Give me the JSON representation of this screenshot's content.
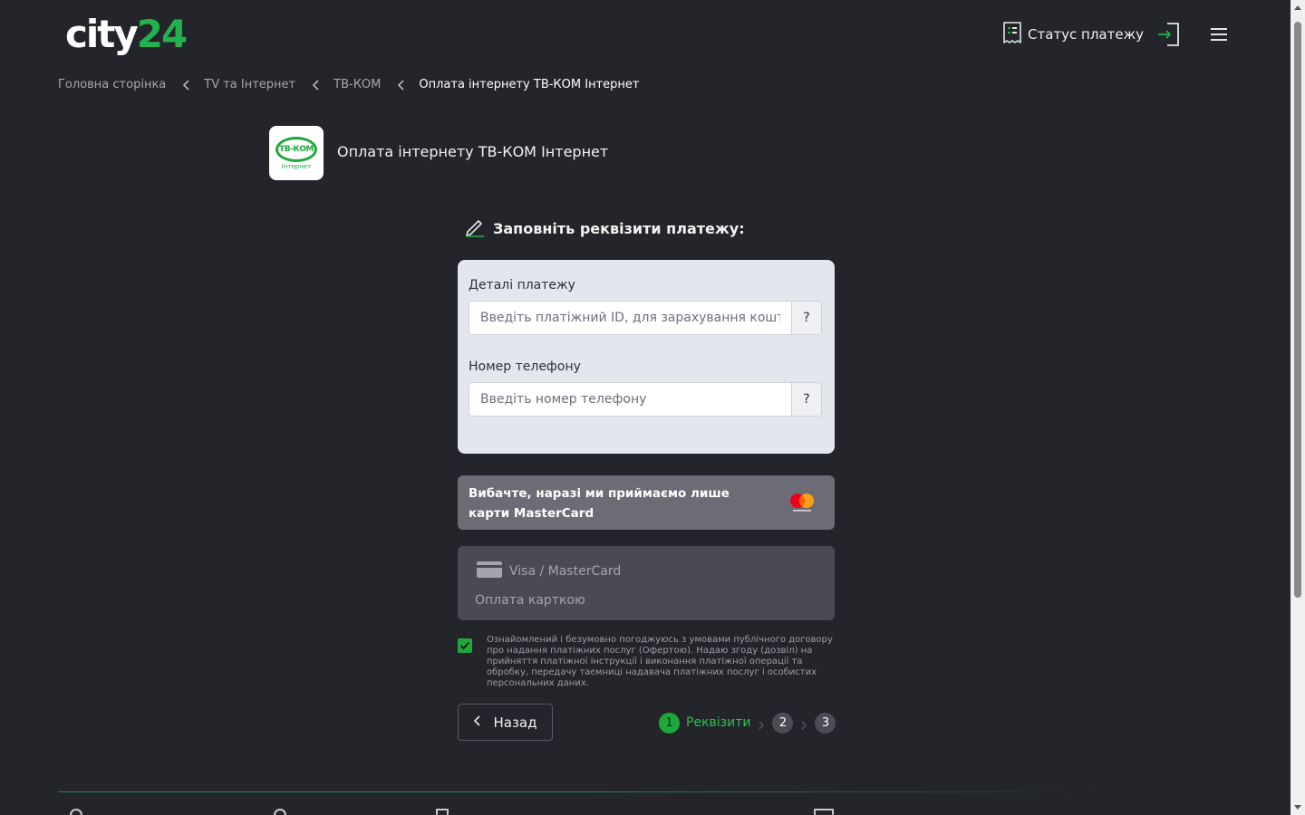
{
  "header": {
    "logo_white": "city",
    "logo_green": "24",
    "status_label": "Статус платежу"
  },
  "breadcrumb": {
    "items": [
      "Головна сторінка",
      "TV та Інтернет",
      "ТВ-КОМ"
    ],
    "current": "Оплата інтернету ТВ-КОМ Інтернет"
  },
  "provider": {
    "logo_text": "ТВ-КОМ",
    "logo_sub": "Інтернет",
    "title": "Оплата інтернету ТВ-КОМ Інтернет"
  },
  "form": {
    "section_title": "Заповніть реквізити платежу:",
    "fields": [
      {
        "label": "Деталі платежу",
        "placeholder": "Введіть платіжний ID, для зарахування коштів",
        "help": "?"
      },
      {
        "label": "Номер телефону",
        "placeholder": "Введіть номер телефону",
        "help": "?"
      }
    ]
  },
  "notice": {
    "text": "Вибачте, наразі ми приймаємо лише карти MasterCard",
    "brand_icon": "mastercard-icon"
  },
  "payment_method": {
    "title": "Visa / MasterCard",
    "subtitle": "Оплата карткою"
  },
  "agreement": {
    "checked": true,
    "text": "Ознайомлений і безумовно погоджуюсь з умовами публічного договору про надання платіжних послуг (Офертою). Надаю згоду (дозвіл) на прийняття платіжної інструкції і виконання платіжної операції та обробку, передачу таємниці надавача платіжних послуг і особистих персональних даних."
  },
  "navigation": {
    "back_label": "Назад",
    "steps": [
      {
        "number": "1",
        "label": "Реквізити",
        "active": true
      },
      {
        "number": "2",
        "label": "",
        "active": false
      },
      {
        "number": "3",
        "label": "",
        "active": false
      }
    ]
  },
  "colors": {
    "background": "#24252a",
    "accent": "#1ea83b",
    "card": "#e3e6ec",
    "notice": "#6c6c76"
  }
}
